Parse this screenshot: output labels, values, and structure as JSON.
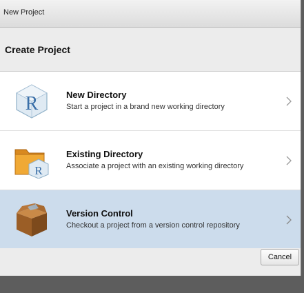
{
  "window": {
    "title": "New Project"
  },
  "header": {
    "title": "Create Project"
  },
  "options": [
    {
      "title": "New Directory",
      "subtitle": "Start a project in a brand new working directory",
      "icon": "r-cube-icon"
    },
    {
      "title": "Existing Directory",
      "subtitle": "Associate a project with an existing working directory",
      "icon": "folder-r-icon"
    },
    {
      "title": "Version Control",
      "subtitle": "Checkout a project from a version control repository",
      "icon": "box-icon",
      "selected": true
    }
  ],
  "footer": {
    "cancel_label": "Cancel"
  },
  "colors": {
    "selected_row": "#ccdcec",
    "window_bg": "#ececec"
  }
}
